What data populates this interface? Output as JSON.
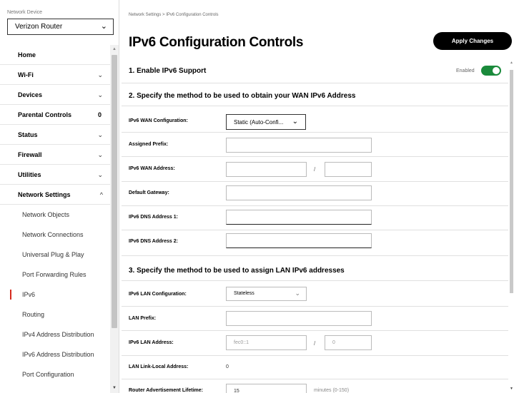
{
  "sidebar": {
    "device_label": "Network Device",
    "device_value": "Verizon Router",
    "items": [
      {
        "label": "Home",
        "chev": ""
      },
      {
        "label": "Wi-Fi",
        "chev": "⌄"
      },
      {
        "label": "Devices",
        "chev": "⌄"
      },
      {
        "label": "Parental Controls",
        "count": "0"
      },
      {
        "label": "Status",
        "chev": "⌄"
      },
      {
        "label": "Firewall",
        "chev": "⌄"
      },
      {
        "label": "Utilities",
        "chev": "⌄"
      },
      {
        "label": "Network Settings",
        "chev": "^"
      }
    ],
    "sub_items": [
      "Network Objects",
      "Network Connections",
      "Universal Plug & Play",
      "Port Forwarding Rules",
      "IPv6",
      "Routing",
      "IPv4 Address Distribution",
      "IPv6 Address Distribution",
      "Port Configuration"
    ]
  },
  "header": {
    "breadcrumb": "Network Settings  >  IPv6 Configuration Controls",
    "title": "IPv6 Configuration Controls",
    "apply_label": "Apply Changes"
  },
  "section1": {
    "title": "1. Enable IPv6 Support",
    "toggle_label": "Enabled"
  },
  "section2": {
    "title": "2. Specify the method to be used to obtain your WAN IPv6 Address",
    "wan_config_label": "IPv6 WAN Configuration:",
    "wan_config_value": "Static (Auto-Confi...",
    "assigned_prefix_label": "Assigned Prefix:",
    "wan_address_label": "IPv6 WAN Address:",
    "slash": "/",
    "default_gateway_label": "Default Gateway:",
    "dns1_label": "IPv6 DNS Address 1:",
    "dns2_label": "IPv6 DNS Address 2:"
  },
  "section3": {
    "title": "3. Specify the method to be used to assign LAN IPv6 addresses",
    "lan_config_label": "IPv6 LAN Configuration:",
    "lan_config_value": "Stateless",
    "lan_prefix_label": "LAN Prefix:",
    "lan_address_label": "IPv6 LAN Address:",
    "lan_address_value": "fec0::1",
    "lan_address_prefix": "0",
    "slash": "/",
    "link_local_label": "LAN Link-Local Address:",
    "link_local_value": "0",
    "router_adv_label": "Router Advertisement Lifetime:",
    "router_adv_value": "15",
    "router_adv_unit": "minutes (0-150)"
  },
  "colors": {
    "accent": "#d52b1e",
    "toggle_on": "#1a8a3b",
    "button_bg": "#000000"
  }
}
